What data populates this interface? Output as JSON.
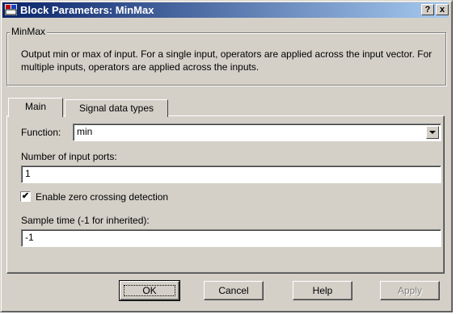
{
  "window": {
    "title": "Block Parameters: MinMax",
    "help_glyph": "?",
    "close_glyph": "x"
  },
  "group": {
    "title": "MinMax",
    "description": "Output min or max of input.  For a single input, operators are applied across the input vector.  For multiple inputs, operators are applied across the inputs."
  },
  "tabs": [
    {
      "label": "Main"
    },
    {
      "label": "Signal data types"
    }
  ],
  "fields": {
    "function_label": "Function:",
    "function_value": "min",
    "ports_label": "Number of input ports:",
    "ports_value": "1",
    "zero_crossing_label": "Enable zero crossing detection",
    "zero_crossing_checked": true,
    "sample_time_label": "Sample time (-1 for inherited):",
    "sample_time_value": "-1"
  },
  "buttons": {
    "ok": "OK",
    "cancel": "Cancel",
    "help": "Help",
    "apply": "Apply"
  },
  "check_glyph": "✔"
}
